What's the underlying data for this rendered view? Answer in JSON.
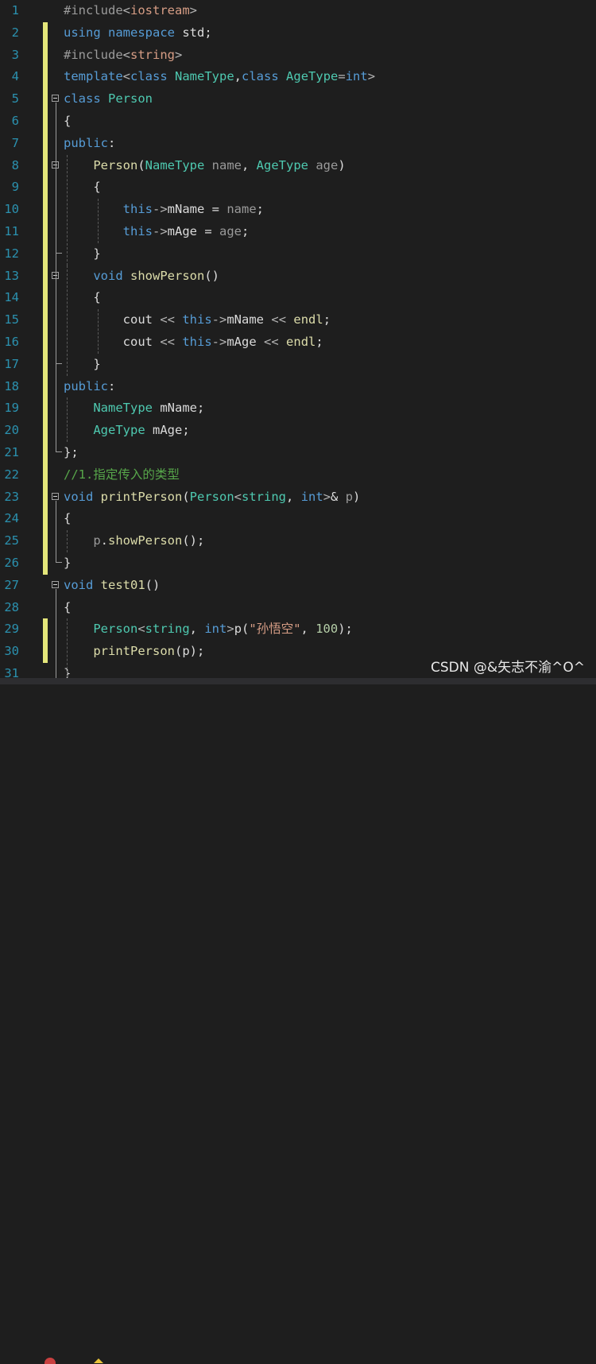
{
  "editor": {
    "colors": {
      "background": "#1e1e1e",
      "line_number": "#2b91af",
      "keyword": "#569cd6",
      "type": "#4ec9b0",
      "function": "#dcdcaa",
      "string": "#d69d85",
      "comment": "#57a64a",
      "preprocessor": "#9b9b9b",
      "change_marker": "#e4e67a"
    },
    "lines": [
      {
        "n": "1",
        "mark": false,
        "fold": false,
        "tokens": [
          [
            "pp",
            "#include"
          ],
          [
            "op",
            "<"
          ],
          [
            "str",
            "iostream"
          ],
          [
            "op",
            ">"
          ]
        ]
      },
      {
        "n": "2",
        "mark": true,
        "fold": false,
        "tokens": [
          [
            "kw",
            "using"
          ],
          [
            "plain",
            " "
          ],
          [
            "kw",
            "namespace"
          ],
          [
            "plain",
            " std;"
          ]
        ]
      },
      {
        "n": "3",
        "mark": true,
        "fold": false,
        "tokens": [
          [
            "pp",
            "#include"
          ],
          [
            "op",
            "<"
          ],
          [
            "str",
            "string"
          ],
          [
            "op",
            ">"
          ]
        ]
      },
      {
        "n": "4",
        "mark": true,
        "fold": false,
        "tokens": [
          [
            "kw",
            "template"
          ],
          [
            "op",
            "<"
          ],
          [
            "kw",
            "class"
          ],
          [
            "plain",
            " "
          ],
          [
            "type",
            "NameType"
          ],
          [
            "plain",
            ","
          ],
          [
            "kw",
            "class"
          ],
          [
            "plain",
            " "
          ],
          [
            "type",
            "AgeType"
          ],
          [
            "op",
            "="
          ],
          [
            "kw",
            "int"
          ],
          [
            "op",
            ">"
          ]
        ]
      },
      {
        "n": "5",
        "mark": true,
        "fold": true,
        "tokens": [
          [
            "kw",
            "class"
          ],
          [
            "plain",
            " "
          ],
          [
            "type",
            "Person"
          ]
        ]
      },
      {
        "n": "6",
        "mark": true,
        "fold": false,
        "tokens": [
          [
            "plain",
            "{"
          ]
        ]
      },
      {
        "n": "7",
        "mark": true,
        "fold": false,
        "tokens": [
          [
            "kw",
            "public"
          ],
          [
            "plain",
            ":"
          ]
        ]
      },
      {
        "n": "8",
        "mark": true,
        "fold": true,
        "tokens": [
          [
            "plain",
            "    "
          ],
          [
            "fn",
            "Person"
          ],
          [
            "plain",
            "("
          ],
          [
            "type",
            "NameType"
          ],
          [
            "plain",
            " "
          ],
          [
            "par",
            "name"
          ],
          [
            "plain",
            ", "
          ],
          [
            "type",
            "AgeType"
          ],
          [
            "plain",
            " "
          ],
          [
            "par",
            "age"
          ],
          [
            "plain",
            ")"
          ]
        ]
      },
      {
        "n": "9",
        "mark": true,
        "fold": false,
        "tokens": [
          [
            "plain",
            "    {"
          ]
        ]
      },
      {
        "n": "10",
        "mark": true,
        "fold": false,
        "tokens": [
          [
            "plain",
            "        "
          ],
          [
            "kw",
            "this"
          ],
          [
            "op",
            "->"
          ],
          [
            "mem",
            "mName"
          ],
          [
            "plain",
            " = "
          ],
          [
            "par",
            "name"
          ],
          [
            "plain",
            ";"
          ]
        ]
      },
      {
        "n": "11",
        "mark": true,
        "fold": false,
        "tokens": [
          [
            "plain",
            "        "
          ],
          [
            "kw",
            "this"
          ],
          [
            "op",
            "->"
          ],
          [
            "mem",
            "mAge"
          ],
          [
            "plain",
            " = "
          ],
          [
            "par",
            "age"
          ],
          [
            "plain",
            ";"
          ]
        ]
      },
      {
        "n": "12",
        "mark": true,
        "fold": false,
        "tokens": [
          [
            "plain",
            "    }"
          ]
        ]
      },
      {
        "n": "13",
        "mark": true,
        "fold": true,
        "tokens": [
          [
            "plain",
            "    "
          ],
          [
            "kw",
            "void"
          ],
          [
            "plain",
            " "
          ],
          [
            "fn",
            "showPerson"
          ],
          [
            "plain",
            "()"
          ]
        ]
      },
      {
        "n": "14",
        "mark": true,
        "fold": false,
        "tokens": [
          [
            "plain",
            "    {"
          ]
        ]
      },
      {
        "n": "15",
        "mark": true,
        "fold": false,
        "tokens": [
          [
            "plain",
            "        cout "
          ],
          [
            "op",
            "<<"
          ],
          [
            "plain",
            " "
          ],
          [
            "kw",
            "this"
          ],
          [
            "op",
            "->"
          ],
          [
            "mem",
            "mName"
          ],
          [
            "plain",
            " "
          ],
          [
            "op",
            "<<"
          ],
          [
            "plain",
            " "
          ],
          [
            "fn",
            "endl"
          ],
          [
            "plain",
            ";"
          ]
        ]
      },
      {
        "n": "16",
        "mark": true,
        "fold": false,
        "tokens": [
          [
            "plain",
            "        cout "
          ],
          [
            "op",
            "<<"
          ],
          [
            "plain",
            " "
          ],
          [
            "kw",
            "this"
          ],
          [
            "op",
            "->"
          ],
          [
            "mem",
            "mAge"
          ],
          [
            "plain",
            " "
          ],
          [
            "op",
            "<<"
          ],
          [
            "plain",
            " "
          ],
          [
            "fn",
            "endl"
          ],
          [
            "plain",
            ";"
          ]
        ]
      },
      {
        "n": "17",
        "mark": true,
        "fold": false,
        "tokens": [
          [
            "plain",
            "    }"
          ]
        ]
      },
      {
        "n": "18",
        "mark": true,
        "fold": false,
        "tokens": [
          [
            "kw",
            "public"
          ],
          [
            "plain",
            ":"
          ]
        ]
      },
      {
        "n": "19",
        "mark": true,
        "fold": false,
        "tokens": [
          [
            "plain",
            "    "
          ],
          [
            "type",
            "NameType"
          ],
          [
            "plain",
            " "
          ],
          [
            "mem",
            "mName"
          ],
          [
            "plain",
            ";"
          ]
        ]
      },
      {
        "n": "20",
        "mark": true,
        "fold": false,
        "tokens": [
          [
            "plain",
            "    "
          ],
          [
            "type",
            "AgeType"
          ],
          [
            "plain",
            " "
          ],
          [
            "mem",
            "mAge"
          ],
          [
            "plain",
            ";"
          ]
        ]
      },
      {
        "n": "21",
        "mark": true,
        "fold": false,
        "tokens": [
          [
            "plain",
            "};"
          ]
        ]
      },
      {
        "n": "22",
        "mark": true,
        "fold": false,
        "tokens": [
          [
            "cm",
            "//1.指定传入的类型"
          ]
        ]
      },
      {
        "n": "23",
        "mark": true,
        "fold": true,
        "tokens": [
          [
            "kw",
            "void"
          ],
          [
            "plain",
            " "
          ],
          [
            "fn",
            "printPerson"
          ],
          [
            "plain",
            "("
          ],
          [
            "type",
            "Person"
          ],
          [
            "op",
            "<"
          ],
          [
            "type",
            "string"
          ],
          [
            "plain",
            ", "
          ],
          [
            "kw",
            "int"
          ],
          [
            "op",
            ">"
          ],
          [
            "plain",
            "& "
          ],
          [
            "par",
            "p"
          ],
          [
            "plain",
            ")"
          ]
        ]
      },
      {
        "n": "24",
        "mark": true,
        "fold": false,
        "tokens": [
          [
            "plain",
            "{"
          ]
        ]
      },
      {
        "n": "25",
        "mark": true,
        "fold": false,
        "tokens": [
          [
            "plain",
            "    "
          ],
          [
            "par",
            "p"
          ],
          [
            "plain",
            "."
          ],
          [
            "fn",
            "showPerson"
          ],
          [
            "plain",
            "();"
          ]
        ]
      },
      {
        "n": "26",
        "mark": true,
        "fold": false,
        "tokens": [
          [
            "plain",
            "}"
          ]
        ]
      },
      {
        "n": "27",
        "mark": false,
        "fold": true,
        "tokens": [
          [
            "kw",
            "void"
          ],
          [
            "plain",
            " "
          ],
          [
            "fn",
            "test01"
          ],
          [
            "plain",
            "()"
          ]
        ]
      },
      {
        "n": "28",
        "mark": false,
        "fold": false,
        "tokens": [
          [
            "plain",
            "{"
          ]
        ]
      },
      {
        "n": "29",
        "mark": true,
        "fold": false,
        "tokens": [
          [
            "plain",
            "    "
          ],
          [
            "type",
            "Person"
          ],
          [
            "op",
            "<"
          ],
          [
            "type",
            "string"
          ],
          [
            "plain",
            ", "
          ],
          [
            "kw",
            "int"
          ],
          [
            "op",
            ">"
          ],
          [
            "plain",
            "p("
          ],
          [
            "str",
            "\"孙悟空\""
          ],
          [
            "plain",
            ", "
          ],
          [
            "num",
            "100"
          ],
          [
            "plain",
            ");"
          ]
        ]
      },
      {
        "n": "30",
        "mark": true,
        "fold": false,
        "tokens": [
          [
            "plain",
            "    "
          ],
          [
            "fn",
            "printPerson"
          ],
          [
            "plain",
            "(p);"
          ]
        ]
      },
      {
        "n": "31",
        "mark": false,
        "fold": false,
        "tokens": [
          [
            "plain",
            "}"
          ]
        ]
      }
    ]
  },
  "watermark": "CSDN @&矢志不渝^O^"
}
